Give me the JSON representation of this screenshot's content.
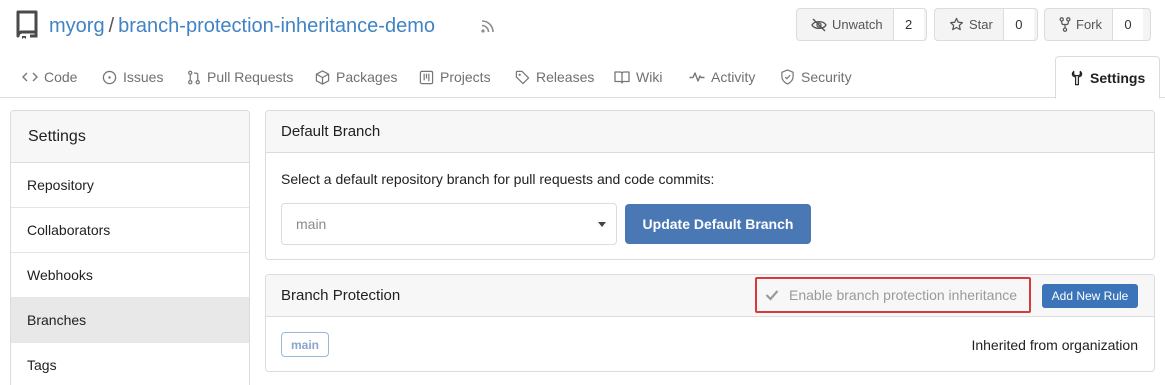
{
  "repo": {
    "owner": "myorg",
    "separator": "/",
    "name": "branch-protection-inheritance-demo"
  },
  "header_buttons": {
    "watch": {
      "label": "Unwatch",
      "count": "2",
      "icon": "eye-slash-icon"
    },
    "star": {
      "label": "Star",
      "count": "0",
      "icon": "star-icon"
    },
    "fork": {
      "label": "Fork",
      "count": "0",
      "icon": "fork-icon"
    }
  },
  "tabs": [
    {
      "label": "Code",
      "icon": "code-icon"
    },
    {
      "label": "Issues",
      "icon": "issues-icon"
    },
    {
      "label": "Pull Requests",
      "icon": "pull-request-icon"
    },
    {
      "label": "Packages",
      "icon": "package-icon"
    },
    {
      "label": "Projects",
      "icon": "projects-icon"
    },
    {
      "label": "Releases",
      "icon": "tag-icon"
    },
    {
      "label": "Wiki",
      "icon": "book-icon"
    },
    {
      "label": "Activity",
      "icon": "pulse-icon"
    },
    {
      "label": "Security",
      "icon": "shield-icon"
    },
    {
      "label": "Settings",
      "icon": "tools-icon",
      "active": true
    }
  ],
  "sidebar": {
    "title": "Settings",
    "items": [
      {
        "label": "Repository"
      },
      {
        "label": "Collaborators"
      },
      {
        "label": "Webhooks"
      },
      {
        "label": "Branches",
        "active": true
      },
      {
        "label": "Tags"
      }
    ]
  },
  "default_branch": {
    "title": "Default Branch",
    "description": "Select a default repository branch for pull requests and code commits:",
    "selected": "main",
    "button": "Update Default Branch"
  },
  "branch_protection": {
    "title": "Branch Protection",
    "inherit_label": "Enable branch protection inheritance",
    "inherit_checked": true,
    "add_rule": "Add New Rule",
    "rules": [
      {
        "branch": "main",
        "status": "Inherited from organization"
      }
    ]
  },
  "colors": {
    "link": "#4183c4",
    "primary": "#4a78b5",
    "highlight_border": "#d63a3a"
  }
}
